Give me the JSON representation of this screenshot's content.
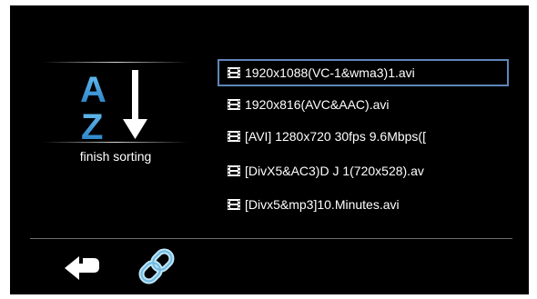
{
  "sort_panel": {
    "icon": "sort-az-descending-icon",
    "letter_top": "A",
    "letter_bottom": "Z",
    "label": "finish sorting",
    "accent_color": "#3c9ad6"
  },
  "files": [
    {
      "name": "1920x1088(VC-1&wma3)1.avi",
      "icon": "film-icon",
      "selected": true
    },
    {
      "name": "1920x816(AVC&AAC).avi",
      "icon": "film-icon",
      "selected": false
    },
    {
      "name": "[AVI] 1280x720 30fps 9.6Mbps([",
      "icon": "film-icon",
      "selected": false
    },
    {
      "name": "[DivX5&AC3)D  J 1(720x528).av",
      "icon": "film-icon",
      "selected": false
    },
    {
      "name": "[Divx5&mp3]10.Minutes.avi",
      "icon": "film-icon",
      "selected": false
    }
  ],
  "selection_color": "#5f86b8",
  "footer": {
    "back_icon": "return-arrow-icon",
    "link_icon": "chain-link-icon"
  }
}
